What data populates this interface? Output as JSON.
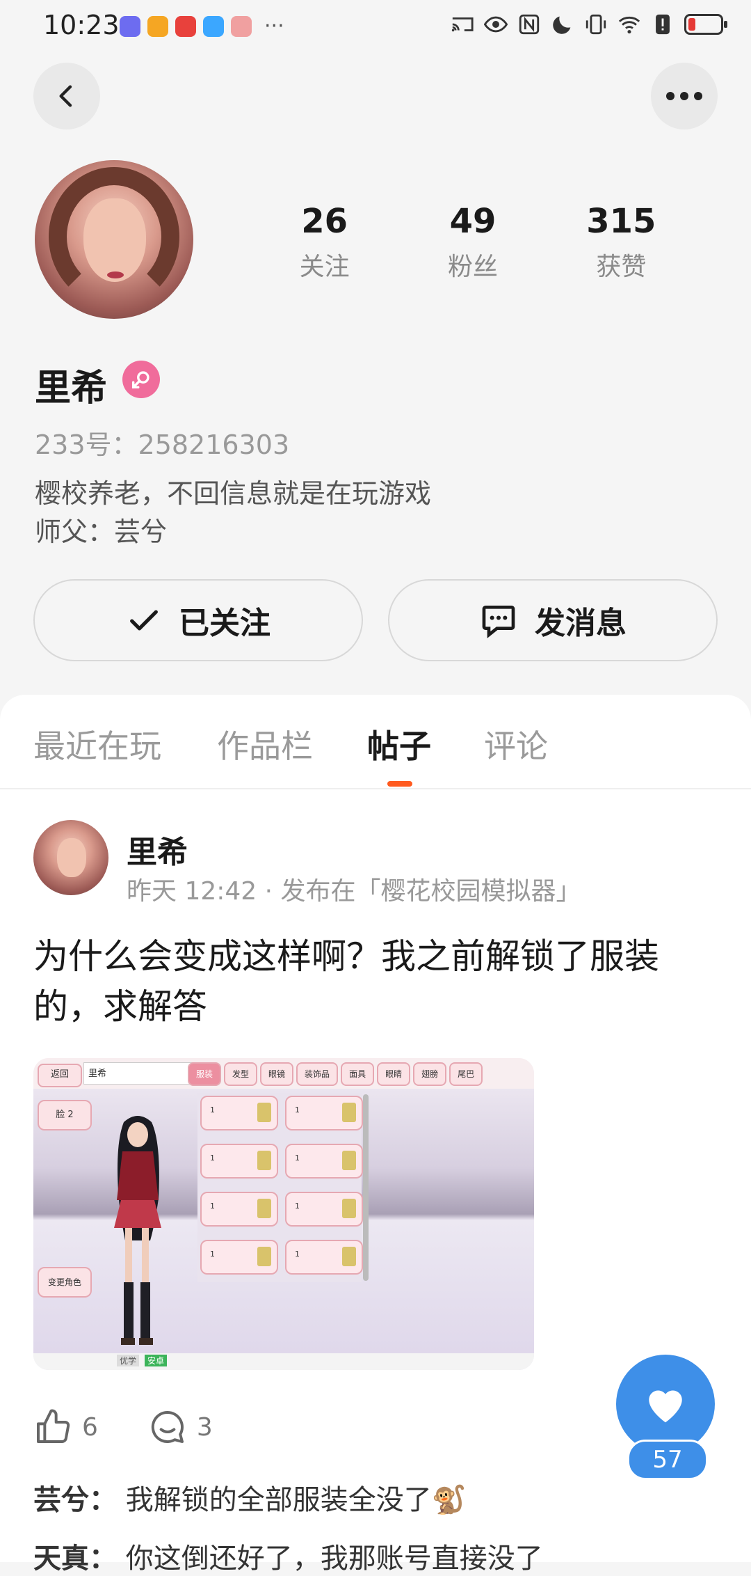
{
  "status_bar": {
    "time": "10:23",
    "more": "···",
    "app_colors": [
      "#6d6cf0",
      "#f5a623",
      "#e8413c",
      "#3ba7ff",
      "#f0a0a0"
    ]
  },
  "profile": {
    "stats": [
      {
        "num": "26",
        "label": "关注"
      },
      {
        "num": "49",
        "label": "粉丝"
      },
      {
        "num": "315",
        "label": "获赞"
      }
    ],
    "name": "里希",
    "uid": "233号：258216303",
    "bio_line1": "樱校养老，不回信息就是在玩游戏",
    "bio_line2": "师父：芸兮",
    "follow_label": "已关注",
    "message_label": "发消息"
  },
  "tabs": [
    "最近在玩",
    "作品栏",
    "帖子",
    "评论"
  ],
  "active_tab": "帖子",
  "post": {
    "author": "里希",
    "meta": "昨天 12:42 · 发布在「樱花校园模拟器」",
    "text": "为什么会变成这样啊？我之前解锁了服装的，求解答",
    "likes": "6",
    "comments": "3",
    "game_screenshot": {
      "back": "返回",
      "name_field": "里希",
      "tabs": [
        "服装",
        "发型",
        "眼镜",
        "装饰品",
        "面具",
        "眼睛",
        "翅膀",
        "尾巴"
      ],
      "face": "脸 2",
      "change_role": "变更角色",
      "slot_label": "1",
      "nav_tag1": "优学",
      "nav_tag2": "安卓"
    }
  },
  "comments": [
    {
      "who": "芸兮：",
      "text": "我解锁的全部服装全没了🐒"
    },
    {
      "who": "天真：",
      "text": "你这倒还好了，我那账号直接没了"
    }
  ],
  "fab": {
    "count": "57",
    "color": "#3e8fe8"
  },
  "accent": "#ff5a1f"
}
